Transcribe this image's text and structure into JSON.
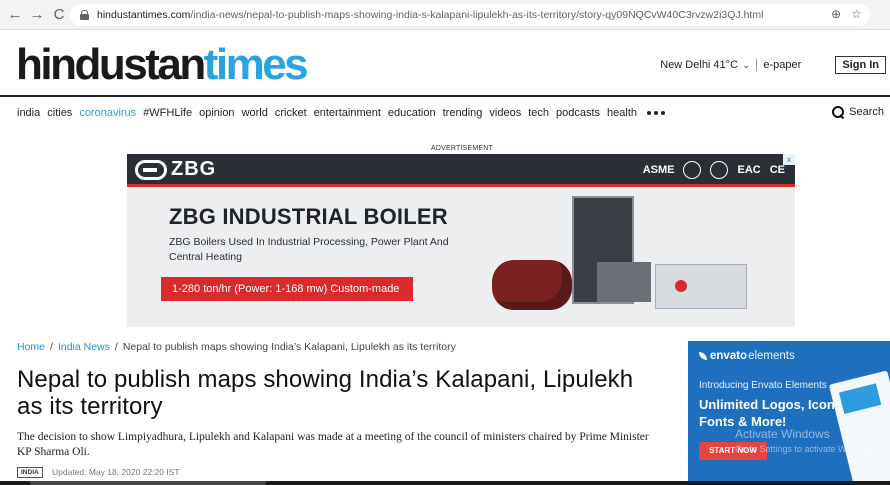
{
  "browser": {
    "url_host": "hindustantimes.com",
    "url_path": "/india-news/nepal-to-publish-maps-showing-india-s-kalapani-lipulekh-as-its-territory/story-qy09NQCvW40C3rvzw2i3QJ.html",
    "back_glyph": "←",
    "forward_glyph": "→",
    "reload_glyph": "C",
    "icons": [
      "add-icon",
      "star-icon"
    ],
    "icon_glyphs": [
      "⊕",
      "☆"
    ]
  },
  "header": {
    "logo_part1": "hindustan",
    "logo_part2": "times",
    "weather": "New Delhi 41°C",
    "chevron": "⌄",
    "epaper": "e-paper",
    "signin": "Sign In"
  },
  "nav": {
    "items": [
      "india",
      "cities",
      "coronavirus",
      "#WFHLife",
      "opinion",
      "world",
      "cricket",
      "entertainment",
      "education",
      "trending",
      "videos",
      "tech",
      "podcasts",
      "health"
    ],
    "search_label": "Search"
  },
  "ad": {
    "label": "ADVERTISEMENT",
    "brand": "ZBG",
    "certs": [
      "ASME",
      "EAC",
      "CE"
    ],
    "headline": "ZBG INDUSTRIAL BOILER",
    "subline": "ZBG Boilers Used In Industrial Processing, Power Plant And Central Heating",
    "cta": "1-280 ton/hr (Power: 1-168 mw) Custom-made",
    "close_glyph": "x"
  },
  "article": {
    "breadcrumb": [
      "Home",
      "India News",
      "Nepal to publish maps showing India’s Kalapani, Lipulekh as its territory"
    ],
    "breadcrumb_sep": "/",
    "headline": "Nepal to publish maps showing India’s Kalapani, Lipulekh as its territory",
    "summary": "The decision to show Limpiyadhura, Lipulekh and Kalapani was made at a meeting of the council of ministers chaired by Prime Minister KP Sharma Oli.",
    "tag": "INDIA",
    "updated": "Updated: May 18, 2020 22:20 IST"
  },
  "envato": {
    "logo_bold": "envato",
    "logo_thin": "elements",
    "intro": "Introducing Envato Elements",
    "title": "Unlimited Logos, Icons, Fonts & More!",
    "button": "START NOW"
  },
  "watermark": {
    "line1": "Activate Windows",
    "line2": "Go to Settings to activate Windows."
  },
  "colors": {
    "accent_blue": "#2aa4dd",
    "ad_red": "#d82c2c",
    "envato_blue": "#1f6fbf"
  }
}
